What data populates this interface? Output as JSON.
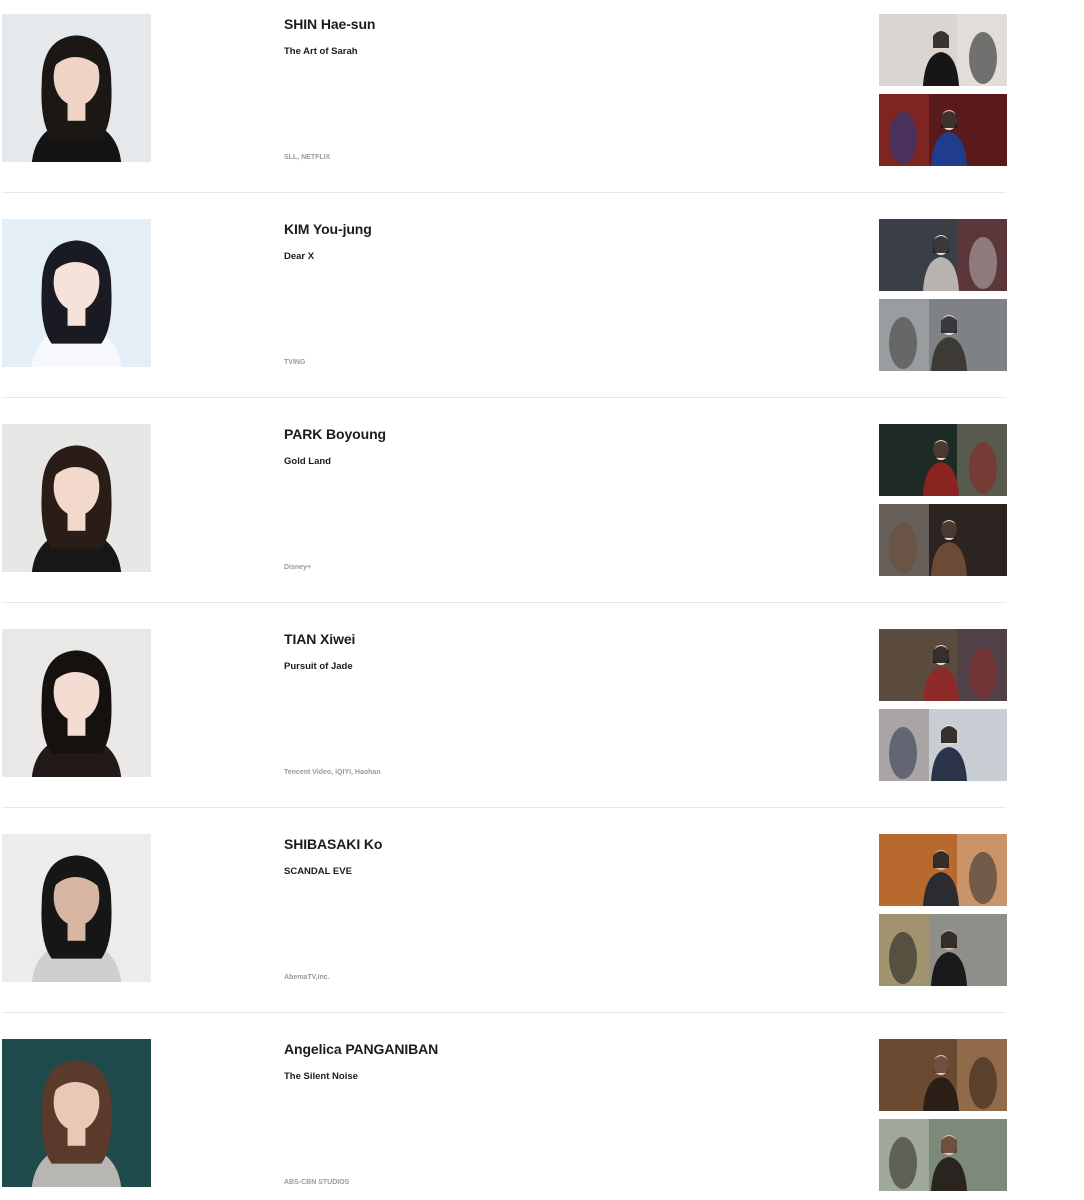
{
  "people": [
    {
      "name": "SHIN Hae-sun",
      "title": "The Art of Sarah",
      "platform": "SLL, NETFLIX",
      "colors": {
        "bg": "#e6e9ec",
        "hair": "#1b1714",
        "skin": "#efd3c4",
        "cloth": "#141414"
      },
      "stills": [
        {
          "bg": "#d9d6d2",
          "accent": "#161616",
          "accent2": "#f0eeea"
        },
        {
          "bg": "#5a1a1c",
          "accent": "#1f3d8c",
          "accent2": "#c43a2c"
        }
      ]
    },
    {
      "name": "KIM You-jung",
      "title": "Dear X",
      "platform": "TVING",
      "colors": {
        "bg": "#e3eef6",
        "hair": "#1a1a22",
        "skin": "#f6e2d8",
        "cloth": "#f7f8fb"
      },
      "stills": [
        {
          "bg": "#3a3e46",
          "accent": "#b9b3b0",
          "accent2": "#9a2a2c"
        },
        {
          "bg": "#7f8284",
          "accent": "#3e3a36",
          "accent2": "#cfd2d3"
        }
      ]
    },
    {
      "name": "PARK Boyoung",
      "title": "Gold Land",
      "platform": "Disney+",
      "colors": {
        "bg": "#e7e8e6",
        "hair": "#2a1c16",
        "skin": "#f2d9cb",
        "cloth": "#171717"
      },
      "stills": [
        {
          "bg": "#1e2a26",
          "accent": "#8a2420",
          "accent2": "#c9b59a"
        },
        {
          "bg": "#2c2420",
          "accent": "#6b4a36",
          "accent2": "#d8d2c8"
        }
      ]
    },
    {
      "name": "TIAN Xiwei",
      "title": "Pursuit of Jade",
      "platform": "Tencent Video, iQIYI, Haohan",
      "colors": {
        "bg": "#e9e8e6",
        "hair": "#15110f",
        "skin": "#f3ddd2",
        "cloth": "#221a18"
      },
      "stills": [
        {
          "bg": "#5b4a3e",
          "accent": "#8e2a2a",
          "accent2": "#3b2e5a"
        },
        {
          "bg": "#c9ced4",
          "accent": "#2a3348",
          "accent2": "#6b5a4a"
        }
      ]
    },
    {
      "name": "SHIBASAKI Ko",
      "title": "SCANDAL EVE",
      "platform": "AbemaTV,Inc.",
      "colors": {
        "bg": "#ececec",
        "hair": "#161616",
        "skin": "#d7b6a4",
        "cloth": "#cfcfd0"
      },
      "stills": [
        {
          "bg": "#b86a2e",
          "accent": "#2c2c30",
          "accent2": "#e8e2d8"
        },
        {
          "bg": "#8f8f8a",
          "accent": "#1a1a1a",
          "accent2": "#c49a3c"
        }
      ]
    },
    {
      "name": "Angelica PANGANIBAN",
      "title": "The Silent Noise",
      "platform": "ABS-CBN STUDIOS",
      "colors": {
        "bg": "#1f4a4c",
        "hair": "#5a3a2a",
        "skin": "#e8c9b6",
        "cloth": "#b8b6b2"
      },
      "stills": [
        {
          "bg": "#6a4a30",
          "accent": "#2b1f18",
          "accent2": "#d9a878"
        },
        {
          "bg": "#7c8a7a",
          "accent": "#2a2420",
          "accent2": "#e2e0d6"
        }
      ]
    }
  ]
}
